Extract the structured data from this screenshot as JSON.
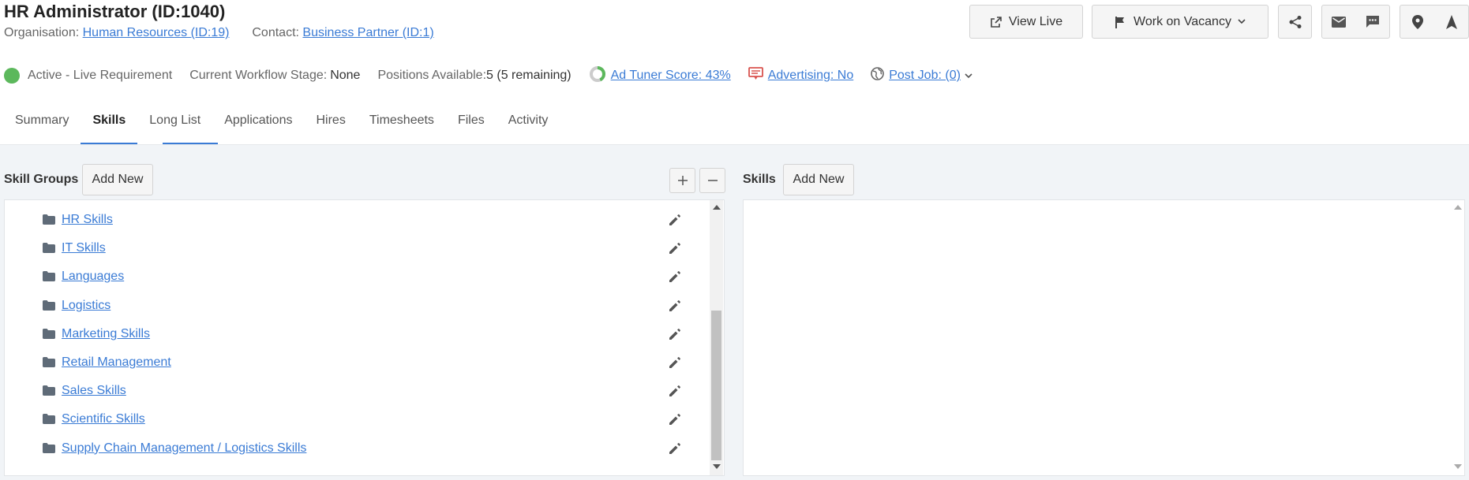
{
  "header": {
    "title": "HR Administrator (ID:1040)",
    "organisation_label": "Organisation:",
    "organisation_link": "Human Resources (ID:19)",
    "contact_label": "Contact:",
    "contact_link": "Business Partner (ID:1)"
  },
  "actions": {
    "view_live": "View Live",
    "work_on_vacancy": "Work on Vacancy"
  },
  "status": {
    "active_text": "Active - Live Requirement",
    "workflow_label": "Current Workflow Stage:",
    "workflow_value": "None",
    "positions_label": "Positions Available:",
    "positions_value": "5 (5 remaining)",
    "ad_tuner": "Ad Tuner Score: 43%",
    "ad_tuner_score": 43,
    "advertising": "Advertising: No",
    "post_job": "Post Job: (0)",
    "active_color": "#5cb85c"
  },
  "tabs": [
    {
      "label": "Summary"
    },
    {
      "label": "Skills",
      "active": true
    },
    {
      "label": "Long List"
    },
    {
      "label": "Applications"
    },
    {
      "label": "Hires"
    },
    {
      "label": "Timesheets"
    },
    {
      "label": "Files"
    },
    {
      "label": "Activity"
    }
  ],
  "skill_groups": {
    "title": "Skill Groups",
    "add_new": "Add New",
    "expand_icon": "plus-icon",
    "collapse_icon": "minus-icon",
    "items": [
      {
        "label": "HR Skills"
      },
      {
        "label": "IT Skills"
      },
      {
        "label": "Languages"
      },
      {
        "label": "Logistics"
      },
      {
        "label": "Marketing Skills"
      },
      {
        "label": "Retail Management"
      },
      {
        "label": "Sales Skills"
      },
      {
        "label": "Scientific Skills"
      },
      {
        "label": "Supply Chain Management / Logistics Skills"
      }
    ]
  },
  "skills": {
    "title": "Skills",
    "add_new": "Add New"
  },
  "colors": {
    "link": "#3a7bd5",
    "tab_underline": "#3a7bd5",
    "panel_bg": "#f1f4f7",
    "advertising_icon": "#d9534f"
  }
}
